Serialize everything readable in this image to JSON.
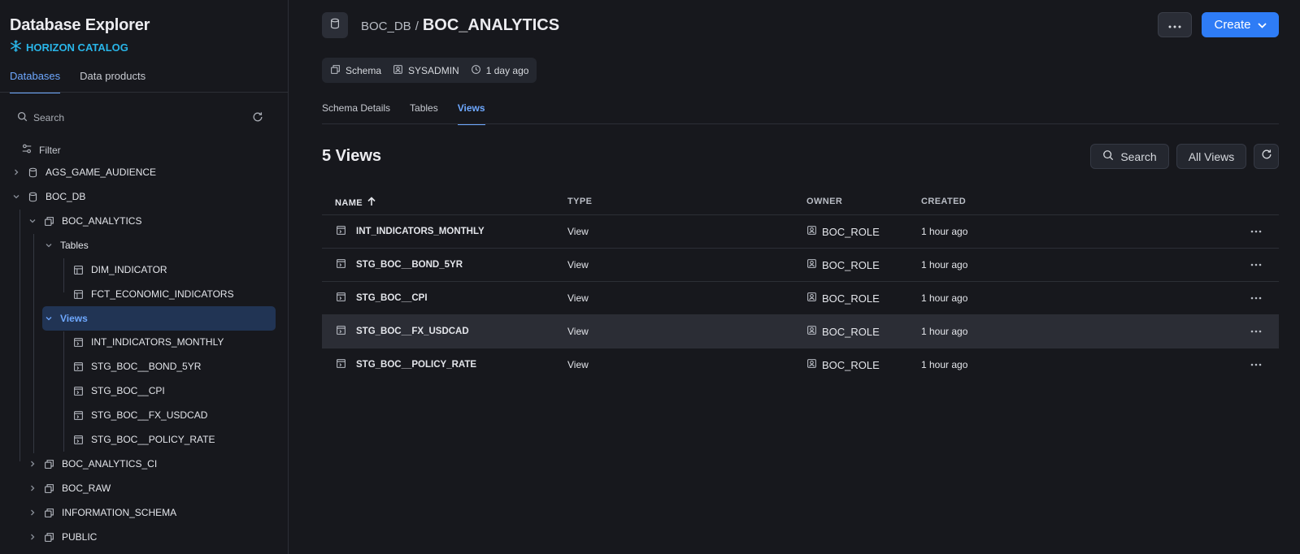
{
  "sidebar": {
    "title": "Database Explorer",
    "catalog_label": "HORIZON CATALOG",
    "tabs": [
      "Databases",
      "Data products"
    ],
    "search_placeholder": "Search",
    "filter_label": "Filter",
    "tree": [
      {
        "label": "AGS_GAME_AUDIENCE",
        "icon": "database-icon",
        "expanded": false
      },
      {
        "label": "BOC_DB",
        "icon": "database-icon",
        "expanded": true
      },
      {
        "label": "BOC_ANALYTICS",
        "icon": "schema-icon",
        "expanded": true
      },
      {
        "label": "Tables",
        "icon": "",
        "expanded": true
      },
      {
        "label": "DIM_INDICATOR",
        "icon": "table-icon"
      },
      {
        "label": "FCT_ECONOMIC_INDICATORS",
        "icon": "table-icon"
      },
      {
        "label": "Views",
        "icon": "",
        "expanded": true,
        "selected": true
      },
      {
        "label": "INT_INDICATORS_MONTHLY",
        "icon": "view-icon"
      },
      {
        "label": "STG_BOC__BOND_5YR",
        "icon": "view-icon"
      },
      {
        "label": "STG_BOC__CPI",
        "icon": "view-icon"
      },
      {
        "label": "STG_BOC__FX_USDCAD",
        "icon": "view-icon"
      },
      {
        "label": "STG_BOC__POLICY_RATE",
        "icon": "view-icon"
      },
      {
        "label": "BOC_ANALYTICS_CI",
        "icon": "schema-icon",
        "expanded": false
      },
      {
        "label": "BOC_RAW",
        "icon": "schema-icon",
        "expanded": false
      },
      {
        "label": "INFORMATION_SCHEMA",
        "icon": "schema-icon",
        "expanded": false
      },
      {
        "label": "PUBLIC",
        "icon": "schema-icon",
        "expanded": false
      }
    ]
  },
  "header": {
    "parent": "BOC_DB",
    "separator": "/",
    "current": "BOC_ANALYTICS",
    "create_label": "Create"
  },
  "meta": {
    "type": "Schema",
    "owner": "SYSADMIN",
    "age": "1 day ago"
  },
  "tabs": [
    "Schema Details",
    "Tables",
    "Views"
  ],
  "active_tab": "Views",
  "views_count_label": "5 Views",
  "toolbar": {
    "search_label": "Search",
    "filter_label": "All Views"
  },
  "table": {
    "columns": [
      "NAME",
      "TYPE",
      "OWNER",
      "CREATED"
    ],
    "rows": [
      {
        "name": "INT_INDICATORS_MONTHLY",
        "type": "View",
        "owner": "BOC_ROLE",
        "created": "1 hour ago"
      },
      {
        "name": "STG_BOC__BOND_5YR",
        "type": "View",
        "owner": "BOC_ROLE",
        "created": "1 hour ago"
      },
      {
        "name": "STG_BOC__CPI",
        "type": "View",
        "owner": "BOC_ROLE",
        "created": "1 hour ago"
      },
      {
        "name": "STG_BOC__FX_USDCAD",
        "type": "View",
        "owner": "BOC_ROLE",
        "created": "1 hour ago"
      },
      {
        "name": "STG_BOC__POLICY_RATE",
        "type": "View",
        "owner": "BOC_ROLE",
        "created": "1 hour ago"
      }
    ]
  },
  "colors": {
    "background": "#17181d",
    "accent": "#6ea8ff",
    "primary_button": "#2e7cf6",
    "brand": "#29b5e8",
    "selected_row": "#213454"
  }
}
